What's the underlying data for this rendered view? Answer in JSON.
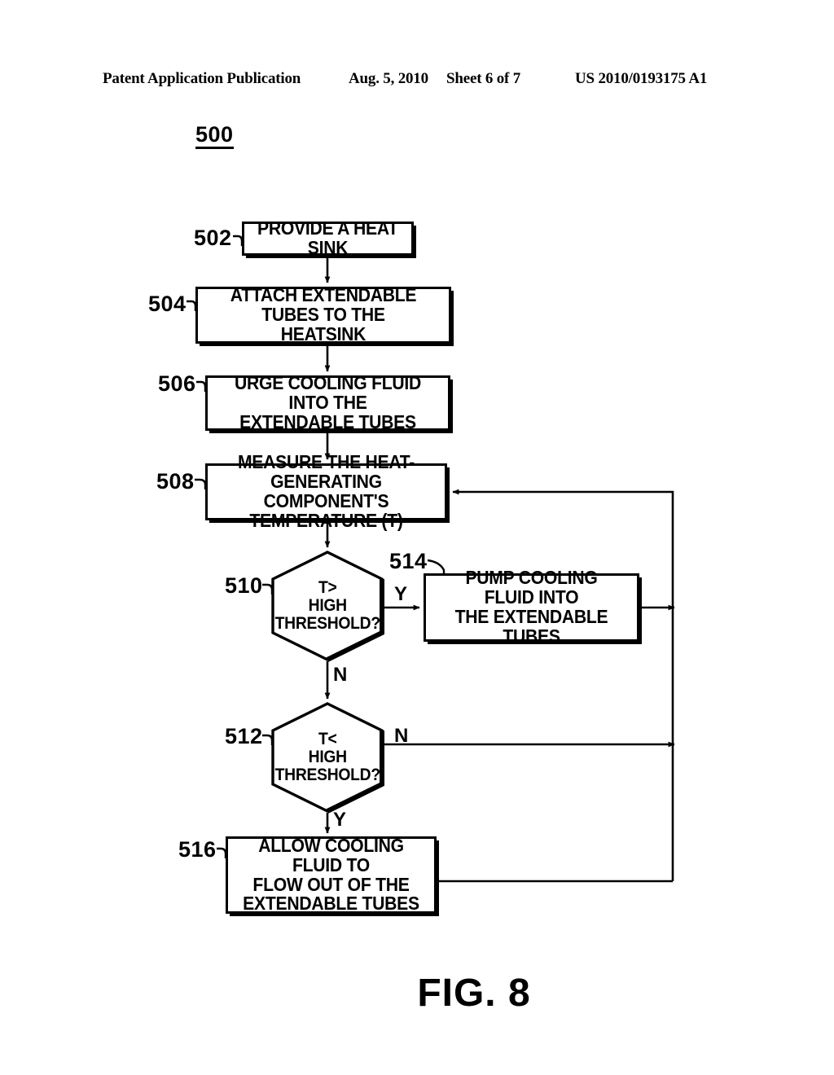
{
  "header": {
    "publication": "Patent Application Publication",
    "date": "Aug. 5, 2010",
    "sheet": "Sheet 6 of 7",
    "patent_number": "US 2010/0193175 A1"
  },
  "figure": {
    "flow_ref": "500",
    "caption": "FIG. 8"
  },
  "nodes": {
    "n502": {
      "ref": "502",
      "text": "PROVIDE A HEAT SINK",
      "type": "process"
    },
    "n504": {
      "ref": "504",
      "text": "ATTACH EXTENDABLE TUBES TO THE\nHEATSINK",
      "type": "process"
    },
    "n506": {
      "ref": "506",
      "text": "URGE COOLING FLUID INTO THE\nEXTENDABLE TUBES",
      "type": "process"
    },
    "n508": {
      "ref": "508",
      "text": "MEASURE THE HEAT-GENERATING\nCOMPONENT'S TEMPERATURE (T)",
      "type": "process"
    },
    "n510": {
      "ref": "510",
      "text": "T>\nHIGH\nTHRESHOLD?",
      "type": "decision"
    },
    "n512": {
      "ref": "512",
      "text": "T<\nHIGH\nTHRESHOLD?",
      "type": "decision"
    },
    "n514": {
      "ref": "514",
      "text": "PUMP COOLING FLUID INTO\nTHE  EXTENDABLE TUBES",
      "type": "process"
    },
    "n516": {
      "ref": "516",
      "text": "ALLOW COOLING FLUID TO\nFLOW OUT OF THE\nEXTENDABLE TUBES",
      "type": "process"
    }
  },
  "branches": {
    "b510_yes": "Y",
    "b510_no": "N",
    "b512_no": "N",
    "b512_yes": "Y"
  },
  "colors": {
    "ink": "#000000",
    "paper": "#ffffff"
  }
}
